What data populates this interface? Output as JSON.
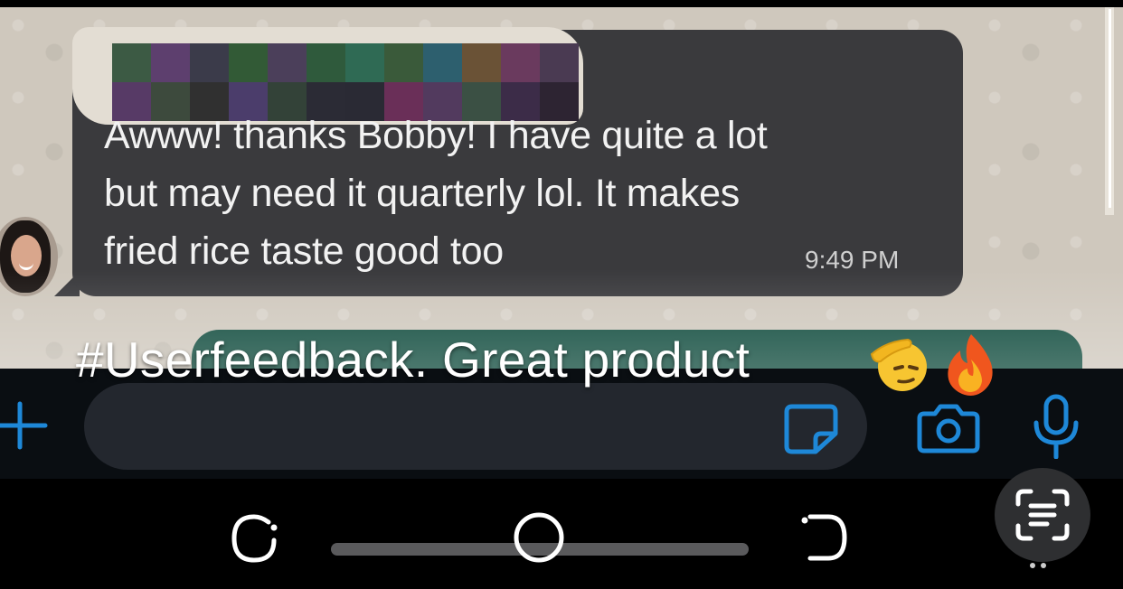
{
  "message": {
    "lines": [
      "Awww! thanks Bobby! I have quite a lot",
      "but may need it quarterly lol. It makes",
      "fried rice taste good too"
    ],
    "time": "9:49 PM"
  },
  "caption": {
    "text": "#Userfeedback. Great product",
    "emojis": [
      "salute-emoji",
      "fire-emoji"
    ]
  },
  "input_bar": {
    "icons": [
      "plus-icon",
      "sticker-icon",
      "camera-icon",
      "microphone-icon"
    ]
  },
  "nav_bar": {
    "icons": [
      "recent-apps-icon",
      "home-icon",
      "back-icon",
      "text-scan-icon"
    ]
  },
  "colors": {
    "incoming_bubble": "#3a3a3d",
    "outgoing_bubble": "#0e4a3c",
    "accent": "#1e88d8",
    "chat_background": "#cfc8bd"
  },
  "redaction_colors": [
    "#3c5a44",
    "#5d3f6e",
    "#3b3b4a",
    "#325a36",
    "#4b3f5a",
    "#2f5a3c",
    "#2f6a54",
    "#3a5a3a",
    "#2d5f6e",
    "#6a5236",
    "#6a3a5e",
    "#4a3a52",
    "#573a66",
    "#3d4a3d",
    "#303030",
    "#4b3d6b",
    "#334238",
    "#2b2b35",
    "#2a2a34",
    "#6a2f58",
    "#523a5e",
    "#3b5044",
    "#3c2c48",
    "#2d2432"
  ]
}
